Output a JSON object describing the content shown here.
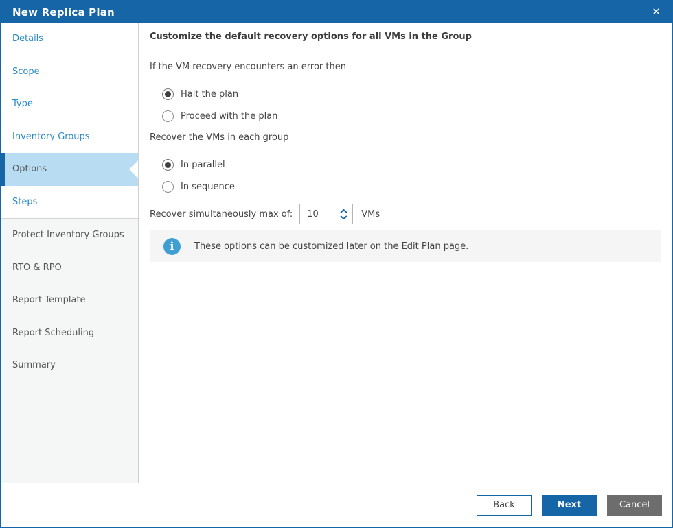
{
  "window": {
    "title": "New Replica Plan",
    "close_icon": "✕"
  },
  "colors": {
    "primary_blue": "#1565a7",
    "link_blue": "#2a8ac6",
    "selected_bg": "#b8ddf2",
    "sidebar_bg": "#f5f6f6",
    "info_icon_blue": "#3f9ed2",
    "cancel_gray": "#6d6d6d",
    "banner_bg": "#f5f5f5"
  },
  "sidebar": {
    "items": [
      {
        "label": "Details",
        "state": "visited"
      },
      {
        "label": "Scope",
        "state": "visited"
      },
      {
        "label": "Type",
        "state": "visited"
      },
      {
        "label": "Inventory Groups",
        "state": "visited"
      },
      {
        "label": "Options",
        "state": "current"
      },
      {
        "label": "Steps",
        "state": "visited"
      },
      {
        "label": "Protect Inventory Groups",
        "state": "upcoming"
      },
      {
        "label": "RTO & RPO",
        "state": "upcoming"
      },
      {
        "label": "Report Template",
        "state": "upcoming"
      },
      {
        "label": "Report Scheduling",
        "state": "upcoming"
      },
      {
        "label": "Summary",
        "state": "upcoming"
      }
    ]
  },
  "content": {
    "heading": "Customize the default recovery options for all VMs in the Group",
    "error_group": {
      "label": "If the VM recovery encounters an error then",
      "options": [
        {
          "label": "Halt the plan",
          "selected": true
        },
        {
          "label": "Proceed with the plan",
          "selected": false
        }
      ]
    },
    "order_group": {
      "label": "Recover the VMs in each group",
      "options": [
        {
          "label": "In parallel",
          "selected": true
        },
        {
          "label": "In sequence",
          "selected": false
        }
      ]
    },
    "max_recover": {
      "label": "Recover simultaneously max of:",
      "value": "10",
      "suffix": "VMs"
    },
    "info_banner": {
      "icon": "i",
      "text": "These options can be customized later on the Edit Plan page."
    }
  },
  "footer": {
    "back_label": "Back",
    "next_label": "Next",
    "cancel_label": "Cancel"
  }
}
